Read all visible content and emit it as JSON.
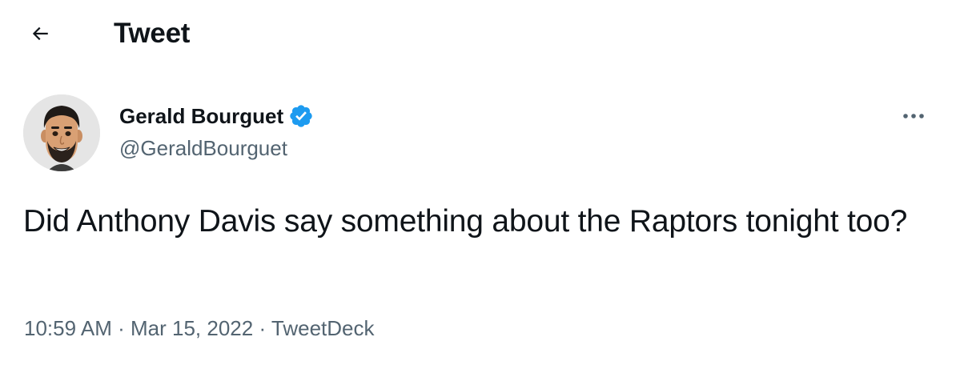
{
  "header": {
    "title": "Tweet",
    "back_icon": "arrow-left-icon"
  },
  "author": {
    "display_name": "Gerald Bourguet",
    "handle": "@GeraldBourguet",
    "verified_icon": "verified-badge-icon",
    "avatar_icon": "avatar-memoji"
  },
  "more_icon": "more-options-icon",
  "tweet": {
    "text": "Did Anthony Davis say something about the Raptors tonight too?"
  },
  "meta": {
    "time": "10:59 AM",
    "separator": "·",
    "date": "Mar 15, 2022",
    "source": "TweetDeck"
  },
  "colors": {
    "text_primary": "#0f1419",
    "text_secondary": "#536471",
    "verified_blue": "#1d9bf0",
    "background": "#ffffff"
  }
}
